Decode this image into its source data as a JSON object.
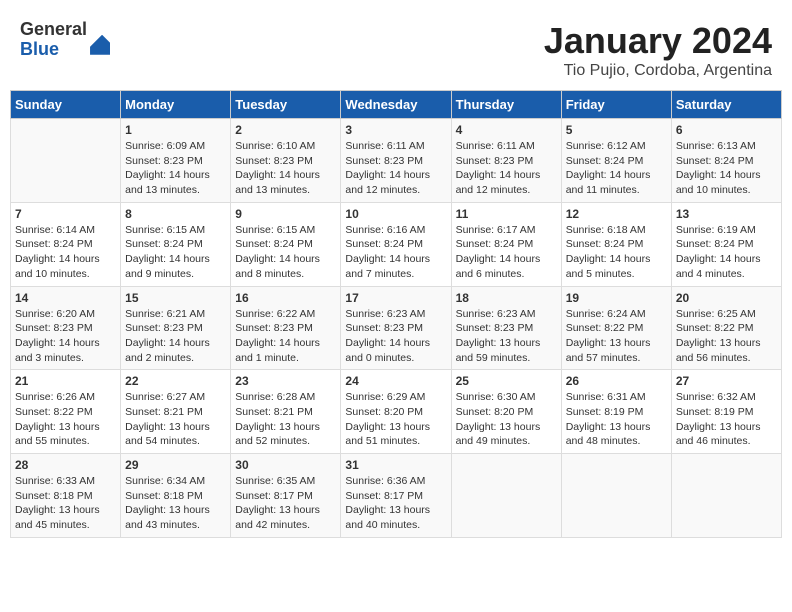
{
  "app": {
    "logo_general": "General",
    "logo_blue": "Blue"
  },
  "header": {
    "title": "January 2024",
    "subtitle": "Tio Pujio, Cordoba, Argentina"
  },
  "calendar": {
    "days_of_week": [
      "Sunday",
      "Monday",
      "Tuesday",
      "Wednesday",
      "Thursday",
      "Friday",
      "Saturday"
    ],
    "weeks": [
      [
        {
          "day": "",
          "info": ""
        },
        {
          "day": "1",
          "info": "Sunrise: 6:09 AM\nSunset: 8:23 PM\nDaylight: 14 hours\nand 13 minutes."
        },
        {
          "day": "2",
          "info": "Sunrise: 6:10 AM\nSunset: 8:23 PM\nDaylight: 14 hours\nand 13 minutes."
        },
        {
          "day": "3",
          "info": "Sunrise: 6:11 AM\nSunset: 8:23 PM\nDaylight: 14 hours\nand 12 minutes."
        },
        {
          "day": "4",
          "info": "Sunrise: 6:11 AM\nSunset: 8:23 PM\nDaylight: 14 hours\nand 12 minutes."
        },
        {
          "day": "5",
          "info": "Sunrise: 6:12 AM\nSunset: 8:24 PM\nDaylight: 14 hours\nand 11 minutes."
        },
        {
          "day": "6",
          "info": "Sunrise: 6:13 AM\nSunset: 8:24 PM\nDaylight: 14 hours\nand 10 minutes."
        }
      ],
      [
        {
          "day": "7",
          "info": "Sunrise: 6:14 AM\nSunset: 8:24 PM\nDaylight: 14 hours\nand 10 minutes."
        },
        {
          "day": "8",
          "info": "Sunrise: 6:15 AM\nSunset: 8:24 PM\nDaylight: 14 hours\nand 9 minutes."
        },
        {
          "day": "9",
          "info": "Sunrise: 6:15 AM\nSunset: 8:24 PM\nDaylight: 14 hours\nand 8 minutes."
        },
        {
          "day": "10",
          "info": "Sunrise: 6:16 AM\nSunset: 8:24 PM\nDaylight: 14 hours\nand 7 minutes."
        },
        {
          "day": "11",
          "info": "Sunrise: 6:17 AM\nSunset: 8:24 PM\nDaylight: 14 hours\nand 6 minutes."
        },
        {
          "day": "12",
          "info": "Sunrise: 6:18 AM\nSunset: 8:24 PM\nDaylight: 14 hours\nand 5 minutes."
        },
        {
          "day": "13",
          "info": "Sunrise: 6:19 AM\nSunset: 8:24 PM\nDaylight: 14 hours\nand 4 minutes."
        }
      ],
      [
        {
          "day": "14",
          "info": "Sunrise: 6:20 AM\nSunset: 8:23 PM\nDaylight: 14 hours\nand 3 minutes."
        },
        {
          "day": "15",
          "info": "Sunrise: 6:21 AM\nSunset: 8:23 PM\nDaylight: 14 hours\nand 2 minutes."
        },
        {
          "day": "16",
          "info": "Sunrise: 6:22 AM\nSunset: 8:23 PM\nDaylight: 14 hours\nand 1 minute."
        },
        {
          "day": "17",
          "info": "Sunrise: 6:23 AM\nSunset: 8:23 PM\nDaylight: 14 hours\nand 0 minutes."
        },
        {
          "day": "18",
          "info": "Sunrise: 6:23 AM\nSunset: 8:23 PM\nDaylight: 13 hours\nand 59 minutes."
        },
        {
          "day": "19",
          "info": "Sunrise: 6:24 AM\nSunset: 8:22 PM\nDaylight: 13 hours\nand 57 minutes."
        },
        {
          "day": "20",
          "info": "Sunrise: 6:25 AM\nSunset: 8:22 PM\nDaylight: 13 hours\nand 56 minutes."
        }
      ],
      [
        {
          "day": "21",
          "info": "Sunrise: 6:26 AM\nSunset: 8:22 PM\nDaylight: 13 hours\nand 55 minutes."
        },
        {
          "day": "22",
          "info": "Sunrise: 6:27 AM\nSunset: 8:21 PM\nDaylight: 13 hours\nand 54 minutes."
        },
        {
          "day": "23",
          "info": "Sunrise: 6:28 AM\nSunset: 8:21 PM\nDaylight: 13 hours\nand 52 minutes."
        },
        {
          "day": "24",
          "info": "Sunrise: 6:29 AM\nSunset: 8:20 PM\nDaylight: 13 hours\nand 51 minutes."
        },
        {
          "day": "25",
          "info": "Sunrise: 6:30 AM\nSunset: 8:20 PM\nDaylight: 13 hours\nand 49 minutes."
        },
        {
          "day": "26",
          "info": "Sunrise: 6:31 AM\nSunset: 8:19 PM\nDaylight: 13 hours\nand 48 minutes."
        },
        {
          "day": "27",
          "info": "Sunrise: 6:32 AM\nSunset: 8:19 PM\nDaylight: 13 hours\nand 46 minutes."
        }
      ],
      [
        {
          "day": "28",
          "info": "Sunrise: 6:33 AM\nSunset: 8:18 PM\nDaylight: 13 hours\nand 45 minutes."
        },
        {
          "day": "29",
          "info": "Sunrise: 6:34 AM\nSunset: 8:18 PM\nDaylight: 13 hours\nand 43 minutes."
        },
        {
          "day": "30",
          "info": "Sunrise: 6:35 AM\nSunset: 8:17 PM\nDaylight: 13 hours\nand 42 minutes."
        },
        {
          "day": "31",
          "info": "Sunrise: 6:36 AM\nSunset: 8:17 PM\nDaylight: 13 hours\nand 40 minutes."
        },
        {
          "day": "",
          "info": ""
        },
        {
          "day": "",
          "info": ""
        },
        {
          "day": "",
          "info": ""
        }
      ]
    ]
  }
}
